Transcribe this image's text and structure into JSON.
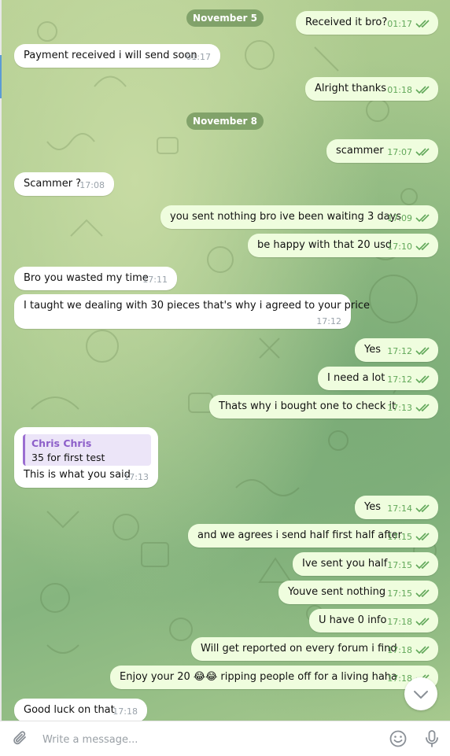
{
  "dates": [
    "November 5",
    "November 8"
  ],
  "messages": [
    {
      "text": "Received it bro?",
      "time": "01:17",
      "dir": "out"
    },
    {
      "text": "Payment received i will send soon",
      "time": "01:17",
      "dir": "in"
    },
    {
      "text": "Alright thanks",
      "time": "01:18",
      "dir": "out"
    },
    {
      "text": "scammer",
      "time": "17:07",
      "dir": "out"
    },
    {
      "text": "Scammer ?",
      "time": "17:08",
      "dir": "in"
    },
    {
      "text": "you sent nothing bro ive been waiting 3 days",
      "time": "17:09",
      "dir": "out"
    },
    {
      "text": "be happy with that 20 usd",
      "time": "17:10",
      "dir": "out"
    },
    {
      "text": "Bro you wasted my time",
      "time": "17:11",
      "dir": "in"
    },
    {
      "text": "I taught we dealing with 30 pieces that's why i agreed to your price",
      "time": "17:12",
      "dir": "in"
    },
    {
      "text": "Yes",
      "time": "17:12",
      "dir": "out"
    },
    {
      "text": "I need a lot",
      "time": "17:12",
      "dir": "out"
    },
    {
      "text": "Thats why i bought one to check it",
      "time": "17:13",
      "dir": "out"
    },
    {
      "text": "This is what you said",
      "time": "17:13",
      "dir": "in",
      "reply_name": "Chris Chris",
      "reply_text": "35 for first test"
    },
    {
      "text": "Yes",
      "time": "17:14",
      "dir": "out"
    },
    {
      "text": "and we agrees i send half first half after",
      "time": "17:15",
      "dir": "out"
    },
    {
      "text": "Ive sent you half",
      "time": "17:15",
      "dir": "out"
    },
    {
      "text": "Youve sent nothing",
      "time": "17:15",
      "dir": "out"
    },
    {
      "text": "U have 0 info",
      "time": "17:18",
      "dir": "out"
    },
    {
      "text": "Will get reported on every forum i find",
      "time": "17:18",
      "dir": "out"
    },
    {
      "text": "Enjoy your 20 😂😂 ripping people off for a living haha",
      "time": "17:18",
      "dir": "out"
    },
    {
      "text": "Good luck on that",
      "time": "17:18",
      "dir": "in"
    }
  ],
  "composer": {
    "placeholder": "Write a message..."
  },
  "icons": {
    "attach": "paperclip-icon",
    "emoji": "smiley-icon",
    "mic": "microphone-icon",
    "scroll": "chevron-down-icon",
    "read": "double-check-icon"
  },
  "colors": {
    "incoming": "#ffffff",
    "outgoing": "#effdde",
    "outgoing_time": "#62a85a",
    "reply_accent": "#8d5fc9"
  }
}
